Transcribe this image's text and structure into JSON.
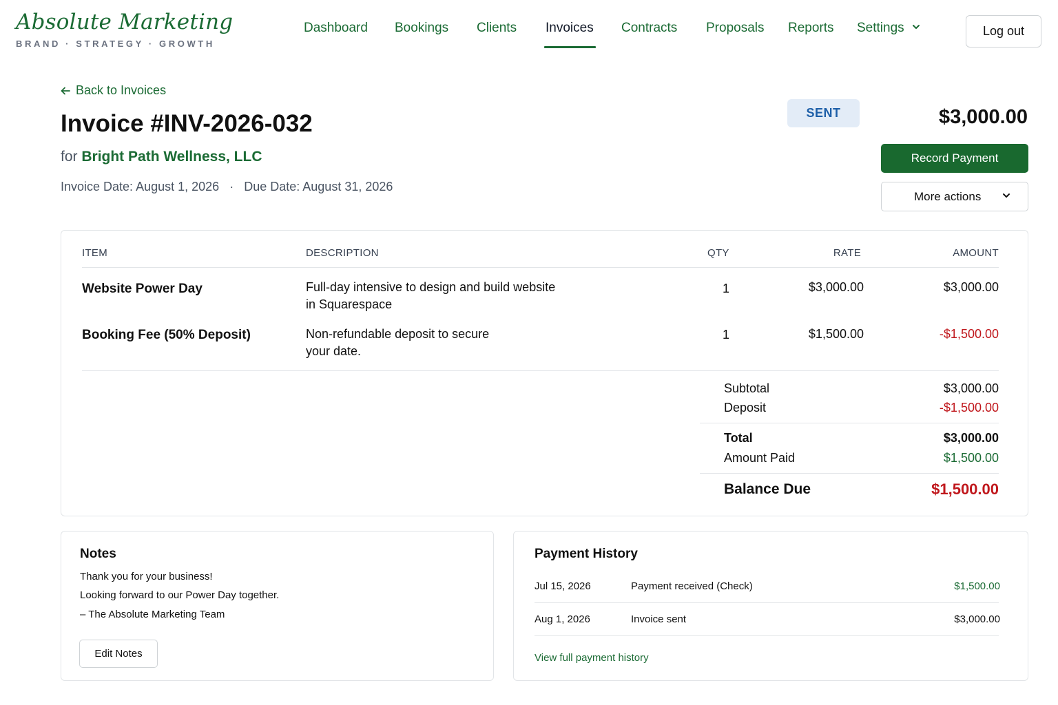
{
  "brand": {
    "name": "Absolute Marketing",
    "tagline": "BRAND · STRATEGY · GROWTH",
    "color": "#1b6b34"
  },
  "nav": {
    "items": [
      {
        "label": "Dashboard",
        "active": false
      },
      {
        "label": "Bookings",
        "active": false
      },
      {
        "label": "Clients",
        "active": false
      },
      {
        "label": "Invoices",
        "active": true
      },
      {
        "label": "Contracts",
        "active": false
      },
      {
        "label": "Proposals",
        "active": false
      },
      {
        "label": "Reports",
        "active": false
      },
      {
        "label": "Settings",
        "active": false,
        "icon": "chevron-down-icon"
      }
    ],
    "logout_label": "Log out"
  },
  "invoice": {
    "back_label": "Back to Invoices",
    "title": "Invoice #INV-2026-032",
    "for_prefix": "for",
    "client": "Bright Path Wellness, LLC",
    "invoice_date_label": "Invoice Date:",
    "invoice_date": "August 1, 2026",
    "separator": "·",
    "due_date_label": "Due Date:",
    "due_date": "August 31, 2026",
    "status": "SENT",
    "status_color": "#1d5fa8",
    "total": "$3,000.00",
    "record_payment_label": "Record Payment",
    "more_actions_label": "More actions"
  },
  "table": {
    "headers": {
      "item": "ITEM",
      "description": "DESCRIPTION",
      "qty": "QTY",
      "rate": "RATE",
      "amount": "AMOUNT"
    },
    "rows": [
      {
        "item": "Website Power Day",
        "description_line1": "Full-day intensive to design and build website",
        "description_line2": "in Squarespace",
        "qty": "1",
        "rate": "$3,000.00",
        "amount": "$3,000.00"
      },
      {
        "item": "Booking Fee (50% Deposit)",
        "description_line1": "Non-refundable deposit to secure",
        "description_line2": "your date.",
        "qty": "1",
        "rate": "$1,500.00",
        "amount": "-$1,500.00"
      }
    ]
  },
  "totals": {
    "subtotal_label": "Subtotal",
    "subtotal": "$3,000.00",
    "deposit_label": "Deposit",
    "deposit": "-$1,500.00",
    "total_label": "Total",
    "total": "$3,000.00",
    "amount_paid_label": "Amount Paid",
    "amount_paid": "$1,500.00",
    "balance_due_label": "Balance Due",
    "balance_due": "$1,500.00",
    "negative_color": "#c0171c",
    "positive_color": "#1b6b34"
  },
  "notes": {
    "title": "Notes",
    "lines": [
      "Thank you for your business!",
      "Looking forward to our Power Day together.",
      "– The Absolute Marketing Team"
    ],
    "edit_label": "Edit Notes"
  },
  "payment_history": {
    "title": "Payment History",
    "entries": [
      {
        "date": "Jul 15, 2026",
        "description": "Payment received (Check)",
        "amount": "$1,500.00",
        "positive": true
      },
      {
        "date": "Aug 1, 2026",
        "description": "Invoice sent",
        "amount": "$3,000.00",
        "positive": false
      }
    ],
    "view_all_label": "View full payment history"
  }
}
